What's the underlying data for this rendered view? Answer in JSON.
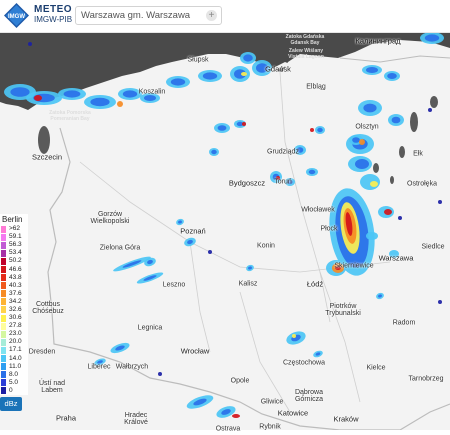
{
  "header": {
    "logo_text": "IMGW",
    "brand_line1": "METEO",
    "brand_line2": "IMGW-PIB",
    "search_value": "Warszawa gm. Warszawa",
    "add_symbol": "+"
  },
  "legend": {
    "title": "Berlin",
    "unit": "dBz",
    "items": [
      {
        "value": ">62",
        "color": "#ff7ad5"
      },
      {
        "value": "59.1",
        "color": "#f57af0"
      },
      {
        "value": "56.3",
        "color": "#c15bd4"
      },
      {
        "value": "53.4",
        "color": "#a630a6"
      },
      {
        "value": "50.2",
        "color": "#c0002a"
      },
      {
        "value": "46.6",
        "color": "#d3141a"
      },
      {
        "value": "43.8",
        "color": "#e52b1a"
      },
      {
        "value": "40.3",
        "color": "#f05a1d"
      },
      {
        "value": "37.6",
        "color": "#f68b24"
      },
      {
        "value": "34.2",
        "color": "#fdb334"
      },
      {
        "value": "32.6",
        "color": "#ffd24a"
      },
      {
        "value": "30.6",
        "color": "#fef04f"
      },
      {
        "value": "27.8",
        "color": "#fffd9c"
      },
      {
        "value": "23.0",
        "color": "#d4f7a0"
      },
      {
        "value": "20.0",
        "color": "#a6ecd8"
      },
      {
        "value": "17.1",
        "color": "#7fe3f0"
      },
      {
        "value": "14.0",
        "color": "#4cc6f5"
      },
      {
        "value": "11.0",
        "color": "#2d9ef1"
      },
      {
        "value": "8.0",
        "color": "#2a70e8"
      },
      {
        "value": "5.0",
        "color": "#2b3ed8"
      },
      {
        "value": "0",
        "color": "#1b1fa4"
      }
    ]
  },
  "map": {
    "colors": {
      "land": "#f3f3f3",
      "sea": "#4a4a4a",
      "border": "#bcbcbc",
      "road": "#cfcfcf"
    },
    "sea_labels": [
      "Zatoka Pomorska Pomeranian Bay",
      "Zatoka Gdańska Gdansk Bay",
      "Zalew Wiślany Vistula Lagoon"
    ],
    "cities": [
      {
        "name": "Калининград",
        "big": true
      },
      {
        "name": "Słupsk"
      },
      {
        "name": "Gdańsk",
        "big": true
      },
      {
        "name": "Elbląg"
      },
      {
        "name": "Koszalin"
      },
      {
        "name": "Olsztyn"
      },
      {
        "name": "Szczecin",
        "big": true
      },
      {
        "name": "Grudziądz"
      },
      {
        "name": "Ełk"
      },
      {
        "name": "Bydgoszcz",
        "big": true
      },
      {
        "name": "Toruń"
      },
      {
        "name": "Ostrołęka"
      },
      {
        "name": "Gorzów Wielkopolski"
      },
      {
        "name": "Włocławek"
      },
      {
        "name": "Poznań",
        "big": true
      },
      {
        "name": "Płock"
      },
      {
        "name": "Warszawa",
        "big": true
      },
      {
        "name": "Konin"
      },
      {
        "name": "Skierniewice"
      },
      {
        "name": "Siedlce"
      },
      {
        "name": "Zielona Góra"
      },
      {
        "name": "Cottbus Chóśebuz"
      },
      {
        "name": "Leszno"
      },
      {
        "name": "Kalisz"
      },
      {
        "name": "Łódź",
        "big": true
      },
      {
        "name": "Legnica"
      },
      {
        "name": "Piotrków Trybunalski"
      },
      {
        "name": "Radom"
      },
      {
        "name": "Wrocław",
        "big": true
      },
      {
        "name": "Opole"
      },
      {
        "name": "Częstochowa"
      },
      {
        "name": "Kielce"
      },
      {
        "name": "Wałbrzych"
      },
      {
        "name": "Liberec"
      },
      {
        "name": "Dresden"
      },
      {
        "name": "Ústí nad Labem"
      },
      {
        "name": "Katowice",
        "big": true
      },
      {
        "name": "Gliwice"
      },
      {
        "name": "Dąbrowa Górnicza"
      },
      {
        "name": "Tarnobrzeg"
      },
      {
        "name": "Kraków",
        "big": true
      },
      {
        "name": "Praha",
        "big": true
      },
      {
        "name": "Hradec Králové"
      },
      {
        "name": "Ostrava"
      },
      {
        "name": "Rybnik"
      }
    ]
  }
}
